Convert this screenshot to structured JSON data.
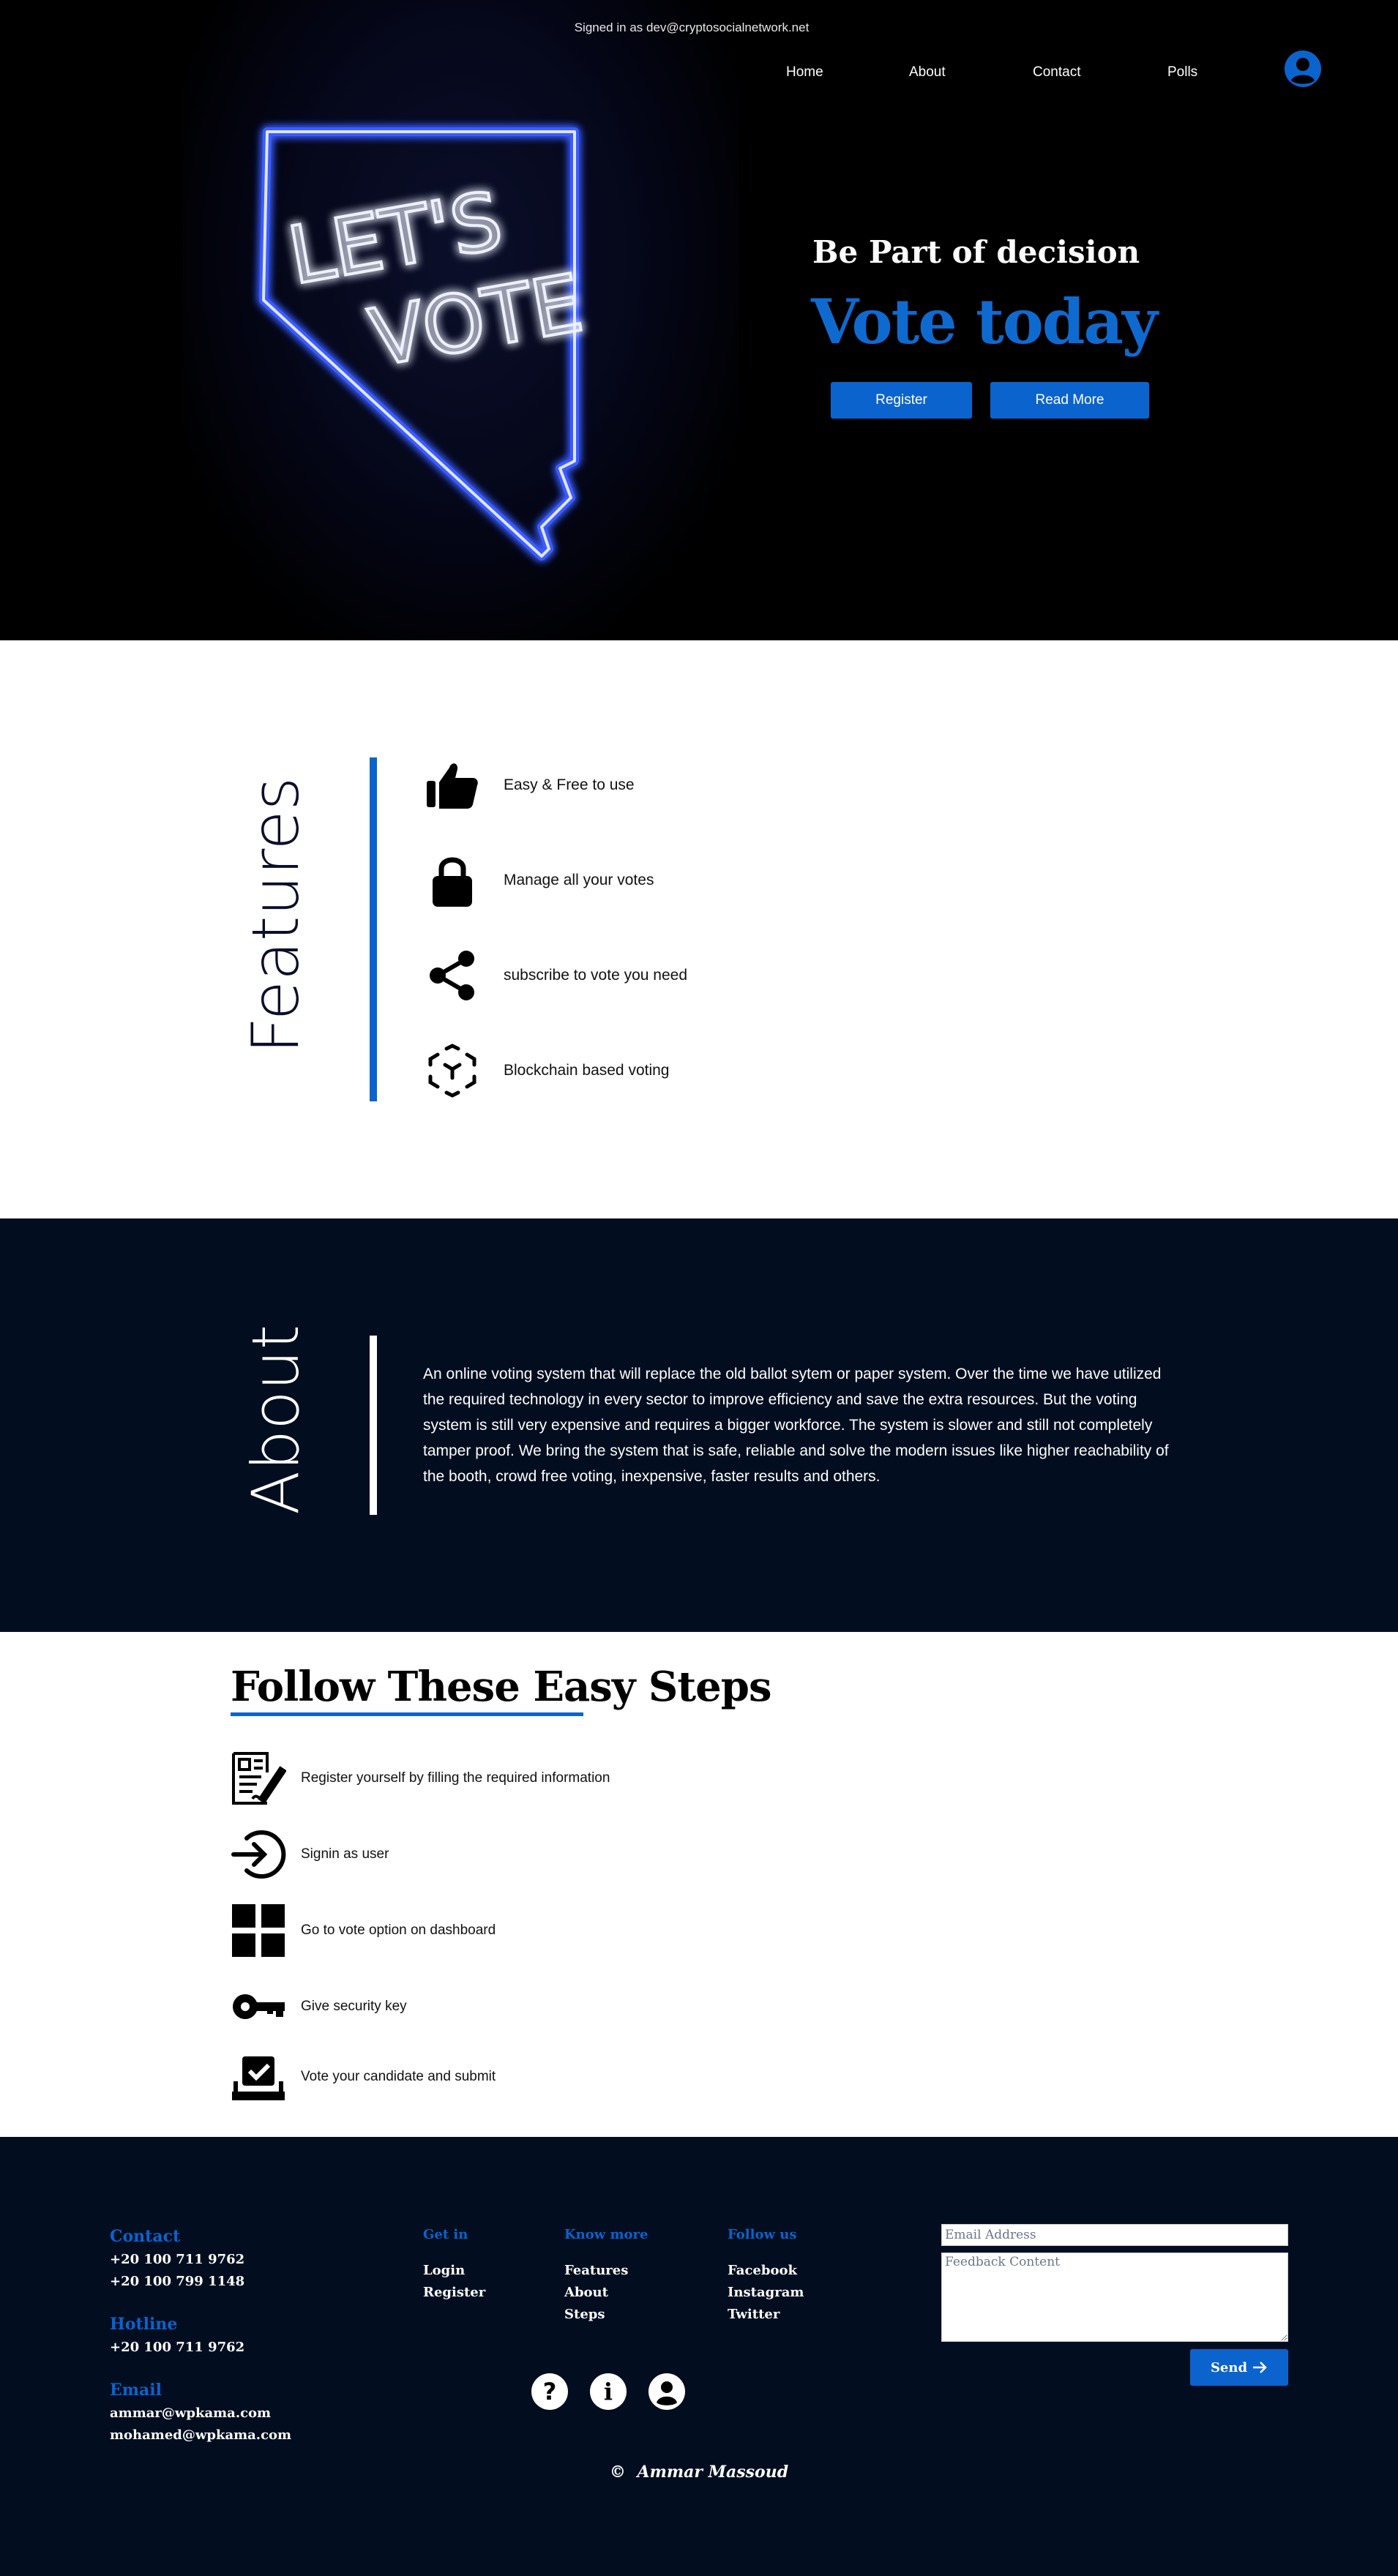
{
  "header": {
    "signed_in": "Signed in as dev@cryptosocialnetwork.net",
    "nav": [
      "Home",
      "About",
      "Contact",
      "Polls"
    ],
    "avatar_icon": "user-circle-icon"
  },
  "hero": {
    "neon_sign_text": [
      "LET'S",
      "VOTE"
    ],
    "subtitle": "Be Part of decision",
    "title": "Vote today",
    "register_label": "Register",
    "read_more_label": "Read More",
    "accent_color": "#0b63ce"
  },
  "features": {
    "title": "Features",
    "items": [
      {
        "icon": "thumbs-up-icon",
        "label": "Easy & Free to use"
      },
      {
        "icon": "lock-icon",
        "label": "Manage all your votes"
      },
      {
        "icon": "share-icon",
        "label": "subscribe to vote you need"
      },
      {
        "icon": "blockchain-cube-icon",
        "label": "Blockchain based voting"
      }
    ]
  },
  "about": {
    "title": "About",
    "text": "An online voting system that will replace the old ballot sytem or paper system. Over the time we have utilized the required technology in every sector to improve efficiency and save the extra resources. But the voting system is still very expensive and requires a bigger workforce. The system is slower and still not completely tamper proof. We bring the system that is safe, reliable and solve the modern issues like higher reachability of the booth, crowd free voting, inexpensive, faster results and others."
  },
  "steps": {
    "title_underlined": "Follow These Easy",
    "title_rest": " Steps",
    "items": [
      {
        "icon": "register-form-icon",
        "label": "Register yourself by filling the required information"
      },
      {
        "icon": "sign-in-icon",
        "label": "Signin as user"
      },
      {
        "icon": "dashboard-grid-icon",
        "label": "Go to vote option on dashboard"
      },
      {
        "icon": "key-icon",
        "label": "Give security key"
      },
      {
        "icon": "ballot-box-icon",
        "label": "Vote your candidate and submit"
      }
    ]
  },
  "footer": {
    "contact_head": "Contact",
    "contact_phones": [
      "+20 100 711 9762",
      "+20 100 799 1148"
    ],
    "hotline_head": "Hotline",
    "hotline_phone": "+20 100 711 9762",
    "email_head": "Email",
    "emails": [
      "ammar@wpkama.com",
      "mohamed@wpkama.com"
    ],
    "get_in_head": "Get in",
    "get_in_links": [
      "Login",
      "Register"
    ],
    "know_more_head": "Know more",
    "know_more_links": [
      "Features",
      "About",
      "Steps"
    ],
    "follow_head": "Follow us",
    "follow_links": [
      "Facebook",
      "Instagram",
      "Twitter"
    ],
    "email_placeholder": "Email Address",
    "feedback_placeholder": "Feedback Content",
    "send_label": "Send",
    "circle_icons": [
      "question-icon",
      "info-icon",
      "user-icon"
    ],
    "copyright_symbol": "©",
    "copyright_name": "Ammar Massoud"
  }
}
